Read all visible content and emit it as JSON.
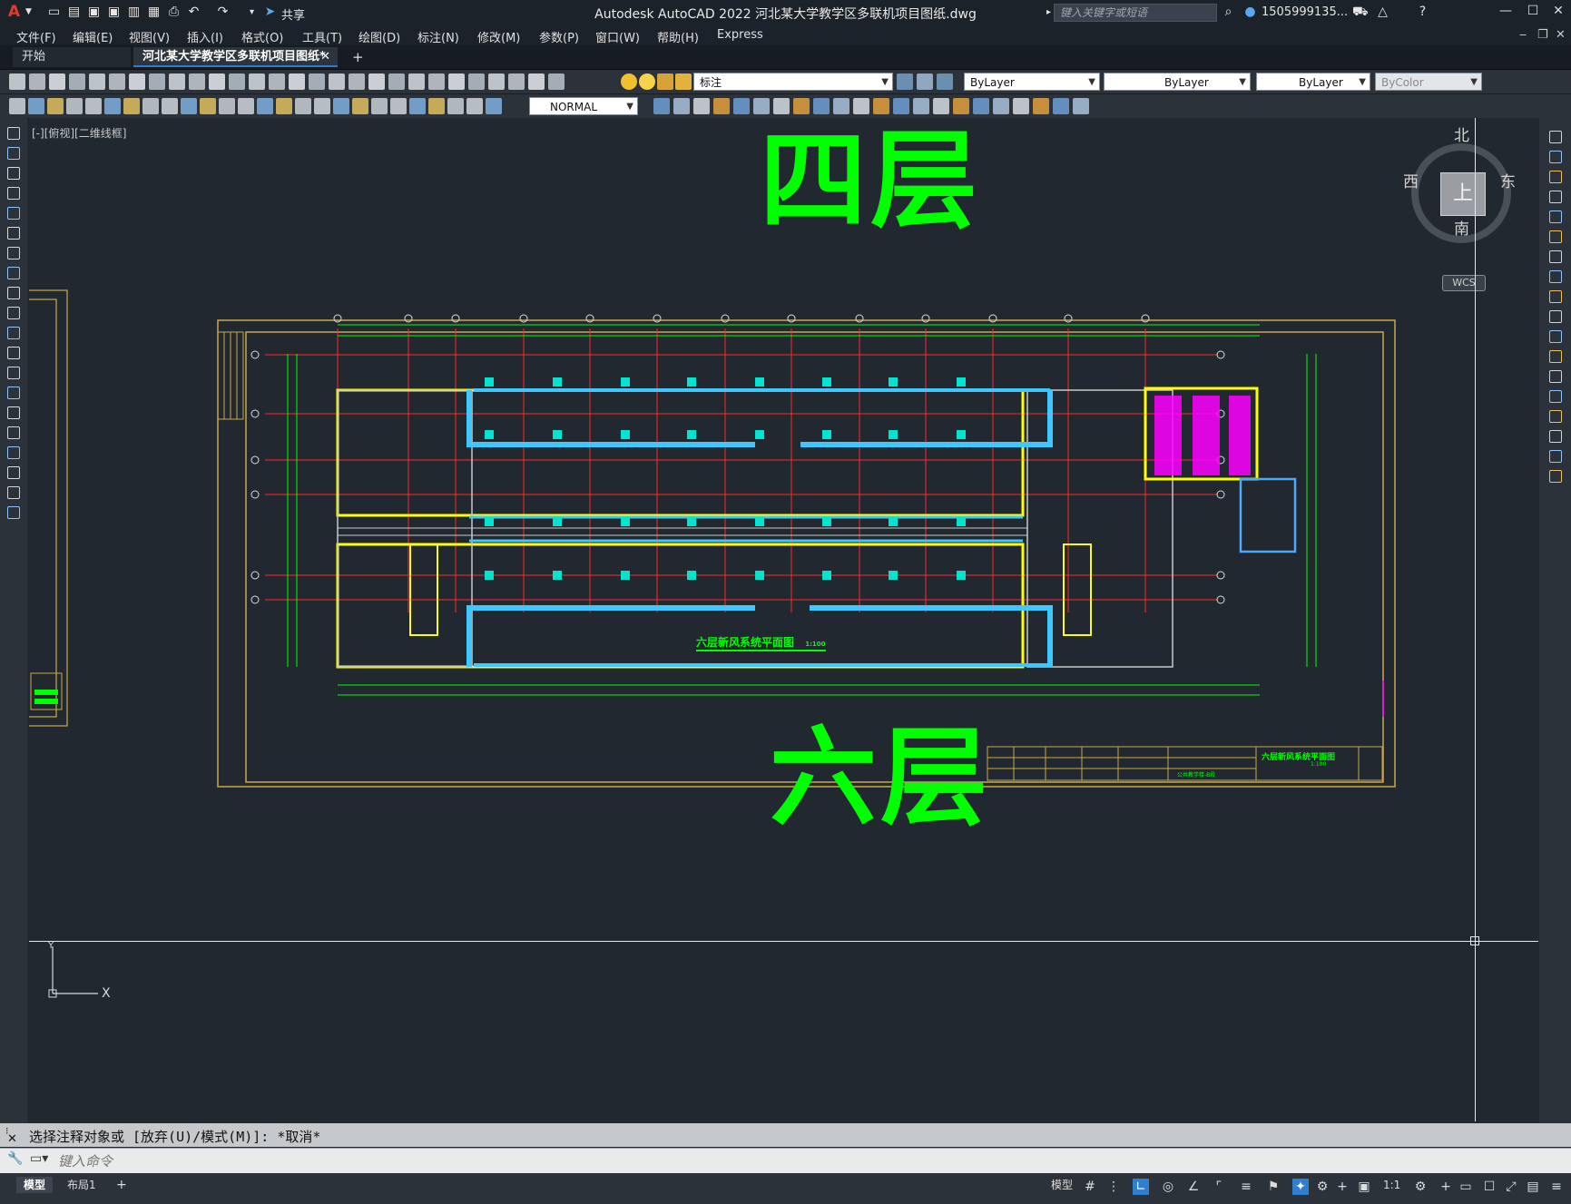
{
  "app": {
    "title": "Autodesk AutoCAD 2022    河北某大学教学区多联机项目图纸.dwg",
    "share_label": "共享",
    "search_placeholder": "键入关键字或短语",
    "user": "1505999135...",
    "logo": "A"
  },
  "menu": [
    "文件(F)",
    "编辑(E)",
    "视图(V)",
    "插入(I)",
    "格式(O)",
    "工具(T)",
    "绘图(D)",
    "标注(N)",
    "修改(M)",
    "参数(P)",
    "窗口(W)",
    "帮助(H)",
    "Express"
  ],
  "tabs": {
    "start": "开始",
    "drawing": "河北某大学教学区多联机项目图纸*"
  },
  "toolbar": {
    "layer_current": "标注",
    "color": "ByLayer",
    "linetype": "ByLayer",
    "lineweight": "ByLayer",
    "plotstyle": "ByColor",
    "dimstyle": "NORMAL"
  },
  "canvas": {
    "viewport_label": "[-][俯视][二维线框]",
    "label_top": "四层",
    "label_bottom": "六层",
    "plan_title": "六层新风系统平面图",
    "plan_scale": "1:100",
    "titleblock_name": "六层新风系统平面图",
    "titleblock_scale": "1:100",
    "titleblock_sub": "公共教学楼-B段"
  },
  "viewcube": {
    "north": "北",
    "south": "南",
    "east": "东",
    "west": "西",
    "face": "上",
    "wcs": "WCS"
  },
  "command": {
    "history": "选择注释对象或 [放弃(U)/模式(M)]: *取消*",
    "placeholder": "键入命令"
  },
  "status": {
    "tab_model": "模型",
    "tab_layout": "布局1",
    "add_tab": "+",
    "model_btn": "模型",
    "scale": "1:1"
  }
}
